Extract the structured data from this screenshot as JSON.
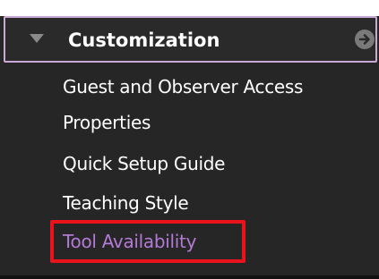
{
  "panel": {
    "header": {
      "title": "Customization",
      "expand_icon": "triangle-down-icon",
      "go_icon": "circle-arrow-right-icon"
    },
    "items": [
      {
        "label": "Guest and Observer Access"
      },
      {
        "label": "Properties"
      },
      {
        "label": "Quick Setup Guide"
      },
      {
        "label": "Teaching Style"
      },
      {
        "label": "Tool Availability",
        "active": true
      }
    ]
  },
  "colors": {
    "panel_bg": "#262626",
    "header_border": "#c9a8d6",
    "text": "#ffffff",
    "active_text": "#b37ad6",
    "highlight_box": "#e8131b"
  }
}
